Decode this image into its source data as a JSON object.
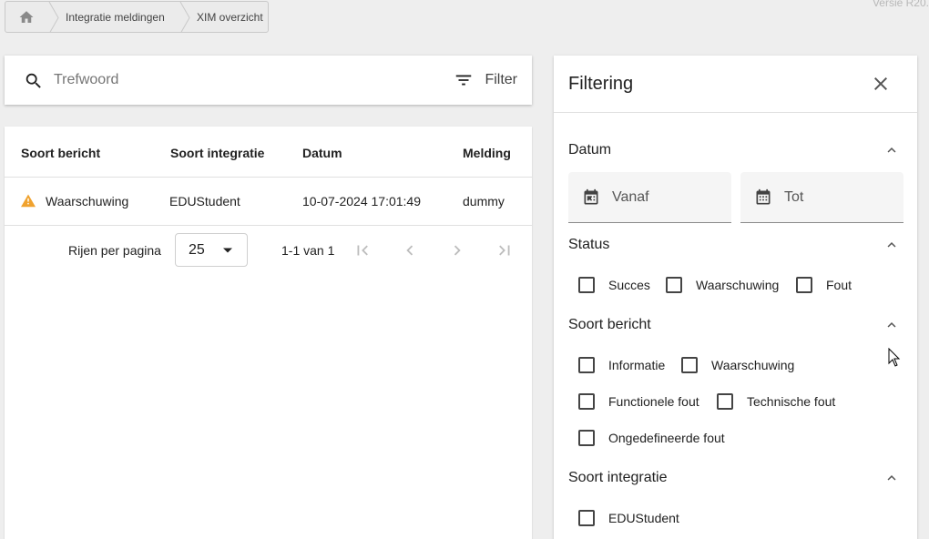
{
  "version": "Versie R20.",
  "breadcrumb": {
    "home_icon": "home-icon",
    "items": [
      "Integratie meldingen",
      "XIM overzicht"
    ]
  },
  "search": {
    "placeholder": "Trefwoord",
    "value": "",
    "filter_label": "Filter"
  },
  "table": {
    "columns": [
      "Soort bericht",
      "Soort integratie",
      "Datum",
      "Melding"
    ],
    "rows": [
      {
        "type_icon": "warning-icon",
        "soort_bericht": "Waarschuwing",
        "soort_integratie": "EDUStudent",
        "datum": "10-07-2024 17:01:49",
        "melding": "dummy"
      }
    ]
  },
  "paginator": {
    "rows_per_page_label": "Rijen per pagina",
    "page_size": "25",
    "range_label": "1-1 van 1"
  },
  "filter_panel": {
    "title": "Filtering",
    "datum": {
      "title": "Datum",
      "from_label": "Vanaf",
      "to_label": "Tot"
    },
    "status": {
      "title": "Status",
      "options": [
        "Succes",
        "Waarschuwing",
        "Fout"
      ]
    },
    "soort_bericht": {
      "title": "Soort bericht",
      "options": [
        "Informatie",
        "Waarschuwing",
        "Functionele fout",
        "Technische fout",
        "Ongedefineerde fout"
      ]
    },
    "soort_integratie": {
      "title": "Soort integratie",
      "options": [
        "EDUStudent"
      ]
    }
  },
  "colors": {
    "background": "#eeeeee",
    "card": "#ffffff",
    "warning": "#f0a22e",
    "text": "#212121"
  }
}
